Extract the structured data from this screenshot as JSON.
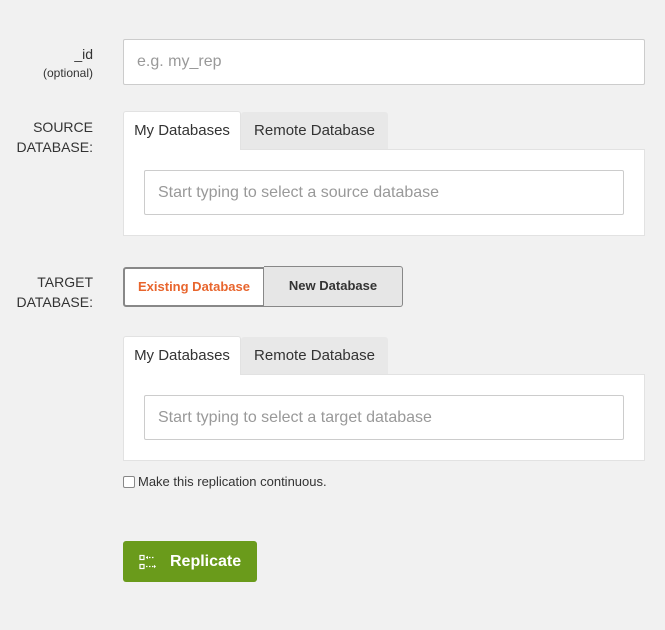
{
  "form": {
    "id_label": "_id",
    "id_sublabel": "(optional)",
    "id_placeholder": "e.g. my_rep",
    "source_label_line1": "SOURCE",
    "source_label_line2": "DATABASE:",
    "target_label_line1": "TARGET",
    "target_label_line2": "DATABASE:"
  },
  "source": {
    "tabs": [
      {
        "label": "My Databases",
        "active": true
      },
      {
        "label": "Remote Database",
        "active": false
      }
    ],
    "placeholder": "Start typing to select a source database"
  },
  "target": {
    "segments": [
      {
        "label": "Existing Database",
        "active": true
      },
      {
        "label": "New Database",
        "active": false
      }
    ],
    "tabs": [
      {
        "label": "My Databases",
        "active": true
      },
      {
        "label": "Remote Database",
        "active": false
      }
    ],
    "placeholder": "Start typing to select a target database"
  },
  "continuous": {
    "label": "Make this replication continuous.",
    "checked": false
  },
  "replicate_button": {
    "label": "Replicate",
    "icon": "replicate-icon",
    "color": "#6a9b1b"
  },
  "colors": {
    "accent_orange": "#e8652d",
    "background": "#f1f1f1"
  }
}
